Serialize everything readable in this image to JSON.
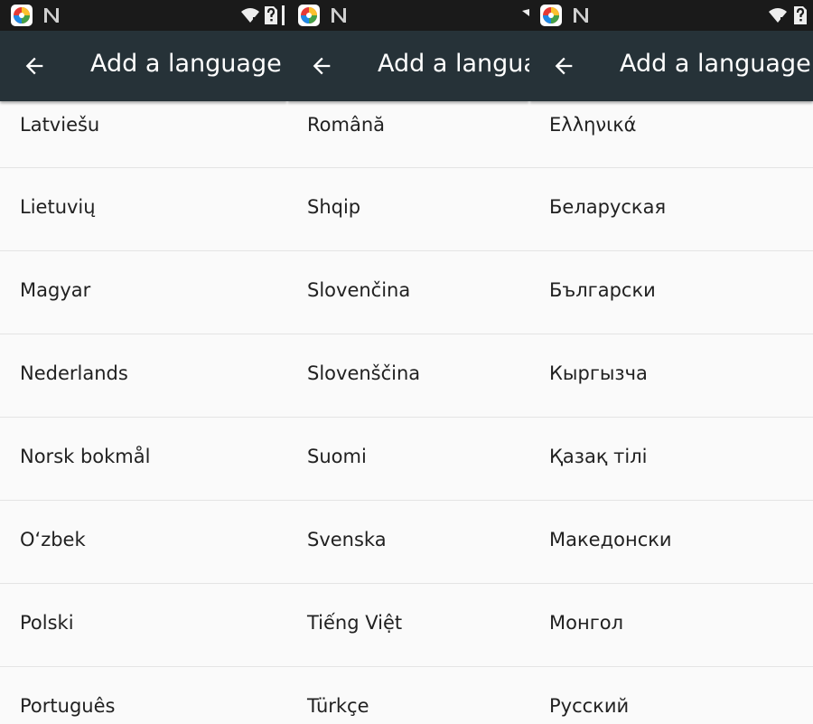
{
  "screen": {
    "title": "Add a language",
    "panels": [
      {
        "items": [
          "Latviešu",
          "Lietuvių",
          "Magyar",
          "Nederlands",
          "Norsk bokmål",
          "Oʻzbek",
          "Polski",
          "Português"
        ]
      },
      {
        "items": [
          "Română",
          "Shqip",
          "Slovenčina",
          "Slovenščina",
          "Suomi",
          "Svenska",
          "Tiếng Việt",
          "Türkçe"
        ]
      },
      {
        "items": [
          "Ελληνικά",
          "Беларуская",
          "Български",
          "Кыргызча",
          "Қазақ тілі",
          "Македонски",
          "Монгол",
          "Русский"
        ]
      }
    ]
  },
  "icons": {
    "back": "arrow-back-icon",
    "status_left": [
      "colorful-app-icon",
      "n-notification-icon"
    ],
    "status_right": [
      "wifi-icon",
      "no-sim-icon"
    ]
  },
  "colors": {
    "status_bar": "#1a1a1a",
    "app_bar": "#263238",
    "background": "#fafafa",
    "divider": "#e4e4e4",
    "text": "#212121"
  }
}
